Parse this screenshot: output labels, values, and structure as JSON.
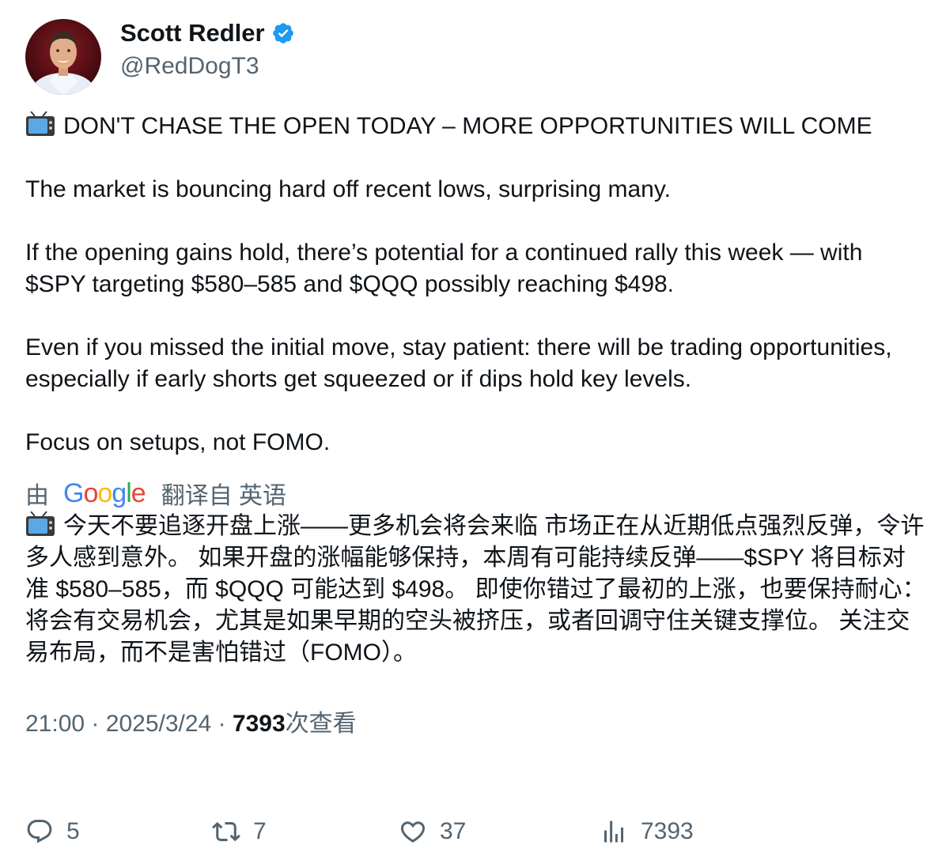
{
  "author": {
    "name": "Scott Redler",
    "handle": "@RedDogT3",
    "verified": true
  },
  "tweet": {
    "paragraphs": [
      "DON'T CHASE THE OPEN TODAY – MORE OPPORTUNITIES WILL COME",
      "The market is bouncing hard off recent lows, surprising many.",
      "If the opening gains hold, there’s potential for a continued rally this week — with $SPY targeting $580–585 and $QQQ possibly reaching $498.",
      "Even if you missed the initial move, stay patient: there will be trading opportunities, especially if early shorts get squeezed or if dips hold key levels.",
      "Focus on setups, not FOMO."
    ],
    "leading_emoji": "tv-icon"
  },
  "translation": {
    "prefix": "由",
    "provider": "Google",
    "suffix": "翻译自 英语",
    "text": "今天不要追逐开盘上涨——更多机会将会来临 市场正在从近期低点强烈反弹，令许多人感到意外。 如果开盘的涨幅能够保持，本周有可能持续反弹——$SPY 将目标对准 $580–585，而 $QQQ 可能达到 $498。 即使你错过了最初的上涨，也要保持耐心：将会有交易机会，尤其是如果早期的空头被挤压，或者回调守住关键支撑位。 关注交易布局，而不是害怕错过（FOMO）。"
  },
  "meta": {
    "time": "21:00",
    "separator": "·",
    "date": "2025/3/24",
    "views": "7393",
    "views_label": "次查看"
  },
  "actions": {
    "replies": "5",
    "retweets": "7",
    "likes": "37",
    "views": "7393"
  },
  "colors": {
    "text": "#0f1419",
    "secondary": "#536471",
    "verified": "#1d9bf0"
  }
}
